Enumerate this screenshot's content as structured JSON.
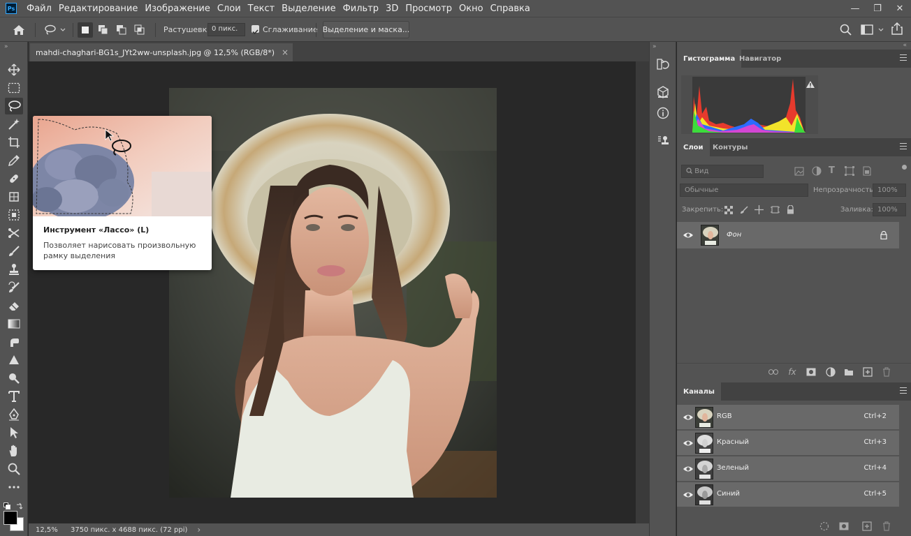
{
  "app": {
    "logo_text": "Ps",
    "menu": [
      "Файл",
      "Редактирование",
      "Изображение",
      "Слои",
      "Текст",
      "Выделение",
      "Фильтр",
      "3D",
      "Просмотр",
      "Окно",
      "Справка"
    ],
    "window_controls": [
      "—",
      "❐",
      "✕"
    ]
  },
  "options": {
    "feather_label": "Растушевка:",
    "feather_value": "0 пикс.",
    "antialias_label": "Сглаживание",
    "antialias_checked": true,
    "select_mask_button": "Выделение и маска..."
  },
  "document": {
    "tab_title": "mahdi-chaghari-BG1s_JYt2ww-unsplash.jpg @ 12,5% (RGB/8*)",
    "tab_close": "×",
    "zoom": "12,5%",
    "size_info": "3750 пикс. x 4688 пикс. (72 ppi)",
    "status_arrow": "›"
  },
  "tooltip": {
    "title": "Инструмент «Лассо» (L)",
    "description": "Позволяет нарисовать произвольную рамку выделения"
  },
  "tools": [
    "move-icon",
    "marquee-icon",
    "lasso-icon",
    "magic-wand-icon",
    "crop-icon",
    "eyedropper-icon",
    "healing-brush-icon",
    "patch-icon",
    "object-select-icon",
    "content-aware-move-icon",
    "brush-icon",
    "clone-stamp-icon",
    "history-brush-icon",
    "eraser-icon",
    "gradient-icon",
    "smudge-icon",
    "sharpen-icon",
    "dodge-icon",
    "type-icon",
    "pen-icon",
    "path-select-icon",
    "hand-icon",
    "zoom-icon",
    "more-icon"
  ],
  "panels": {
    "histogram_tabs": [
      "Гистограмма",
      "Навигатор"
    ],
    "layers_tabs": [
      "Слои",
      "Контуры"
    ],
    "layers_filter_placeholder": "Вид",
    "blend_mode": "Обычные",
    "opacity_label": "Непрозрачность:",
    "opacity_value": "100%",
    "lock_label": "Закрепить:",
    "fill_label": "Заливка:",
    "fill_value": "100%",
    "layers": [
      {
        "name": "Фон"
      }
    ],
    "channels_tab": "Каналы",
    "channels": [
      {
        "name": "RGB",
        "shortcut": "Ctrl+2"
      },
      {
        "name": "Красный",
        "shortcut": "Ctrl+3"
      },
      {
        "name": "Зеленый",
        "shortcut": "Ctrl+4"
      },
      {
        "name": "Синий",
        "shortcut": "Ctrl+5"
      }
    ]
  },
  "colors": {
    "panel_bg": "#535353",
    "canvas_bg": "#282828",
    "selected_row": "#696969",
    "accent": "#31a8ff"
  }
}
